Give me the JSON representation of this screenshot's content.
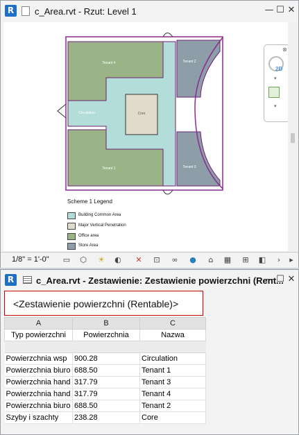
{
  "floorplan_window": {
    "title": "c_Area.rvt - Rzut: Level 1",
    "scale_label": "1/8\" = 1'-0\"",
    "nav_2d_label": "2D",
    "rooms": [
      {
        "label": "Tenant 4"
      },
      {
        "label": "Tenant 1"
      },
      {
        "label": "Circulation"
      },
      {
        "label": "Core"
      },
      {
        "label": "Tenant 2"
      },
      {
        "label": "Tenant 3"
      }
    ],
    "legend": {
      "title": "Scheme 1 Legend",
      "items": [
        {
          "label": "Building Common Area",
          "color": "#b3ddd8"
        },
        {
          "label": "Major Vertical Penetration",
          "color": "#e0dccb"
        },
        {
          "label": "Office area",
          "color": "#9bb487"
        },
        {
          "label": "Store Area",
          "color": "#8e9ea8"
        }
      ]
    },
    "colors": {
      "office": "#9bb487",
      "common": "#b3ddd8",
      "core": "#e0dccb",
      "store": "#8e9ea8",
      "boundary": "#8a2a8f"
    }
  },
  "schedule_window": {
    "title": "c_Area.rvt - Zestawienie: Zestawienie powierzchni (Rent...",
    "schedule_title": "<Zestawienie powierzchni (Rentable)>",
    "column_letters": [
      "A",
      "B",
      "C"
    ],
    "column_headers": [
      "Typ powierzchni",
      "Powierzchnia",
      "Nazwa"
    ],
    "rows": [
      [
        "Powierzchnia wsp",
        "900.28",
        "Circulation"
      ],
      [
        "Powierzchnia biuro",
        "688.50",
        "Tenant 1"
      ],
      [
        "Powierzchnia hand",
        "317.79",
        "Tenant 3"
      ],
      [
        "Powierzchnia hand",
        "317.79",
        "Tenant 4"
      ],
      [
        "Powierzchnia biuro",
        "688.50",
        "Tenant 2"
      ],
      [
        "Szyby i szachty",
        "238.28",
        "Core"
      ]
    ]
  },
  "window_buttons": {
    "minimize": "—",
    "maximize": "☐",
    "close": "✕"
  }
}
